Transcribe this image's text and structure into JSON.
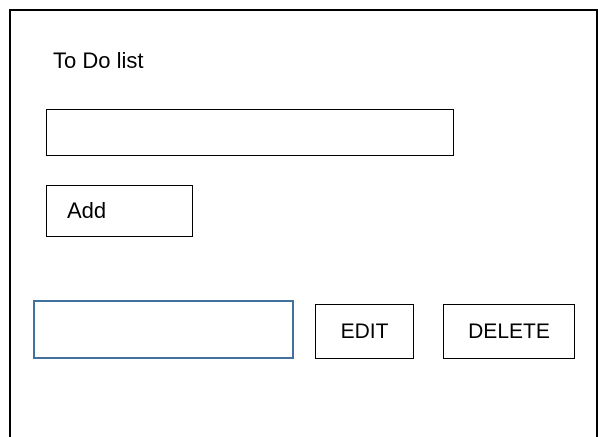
{
  "app": {
    "title": "To Do list"
  },
  "new_task": {
    "value": "",
    "placeholder": "",
    "add_label": "Add"
  },
  "items": [
    {
      "value": "",
      "edit_label": "EDIT",
      "delete_label": "DELETE"
    }
  ],
  "colors": {
    "border": "#000000",
    "item_field_border": "#41719c",
    "background": "#ffffff"
  }
}
